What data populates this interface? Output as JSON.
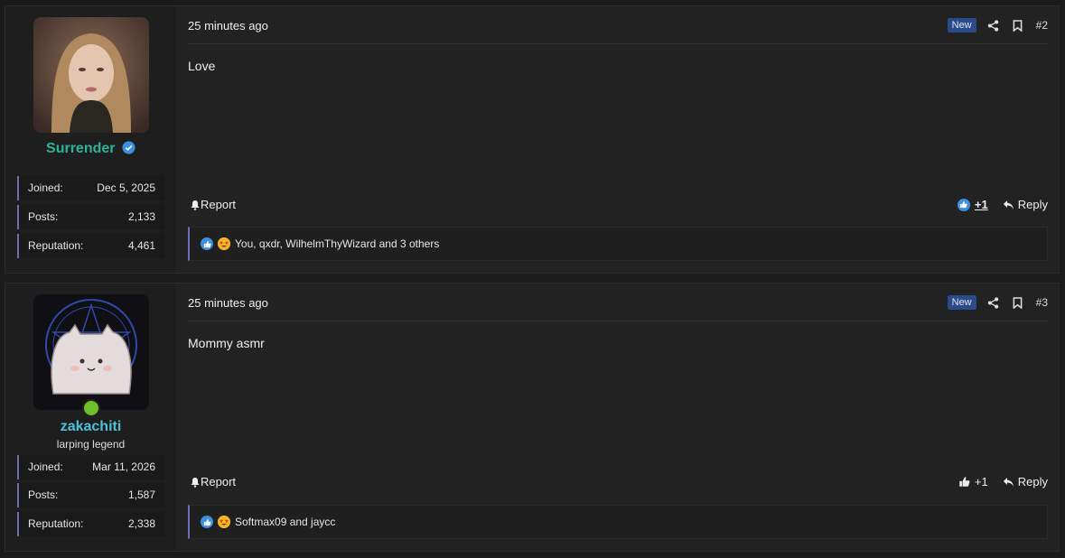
{
  "colors": {
    "verified": "#3d8fe0",
    "name1": "#2eb39a",
    "name2": "#4ec0d8",
    "online": "#6fbf2a",
    "accent": "#6e6eb5"
  },
  "labels": {
    "joined": "Joined:",
    "posts": "Posts:",
    "reputation": "Reputation:",
    "report": "Report",
    "reply": "Reply",
    "new": "New"
  },
  "posts": [
    {
      "username": "Surrender",
      "joined": "Dec 5, 2025",
      "posts": "2,133",
      "reputation": "4,461",
      "time": "25 minutes ago",
      "number": "#2",
      "body": "Love",
      "plus": "+1",
      "reactions": "You, qxdr, WilhelmThyWizard and 3 others"
    },
    {
      "username": "zakachiti",
      "title": "larping legend",
      "joined": "Mar 11, 2026",
      "posts": "1,587",
      "reputation": "2,338",
      "time": "25 minutes ago",
      "number": "#3",
      "body": "Mommy asmr",
      "plus": "+1",
      "reactions": "Softmax09 and jaycc"
    }
  ]
}
